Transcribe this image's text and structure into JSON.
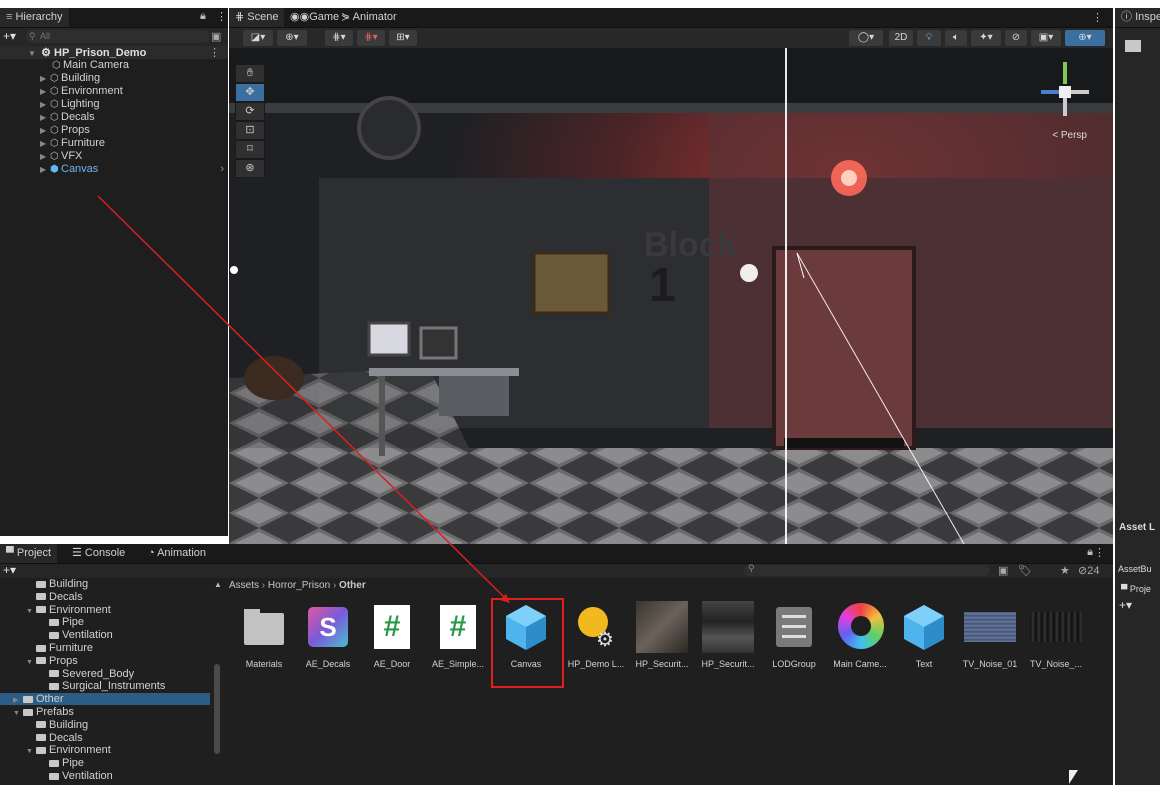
{
  "hierarchy": {
    "tab": "Hierarchy",
    "search_placeholder": "All",
    "root": "HP_Prison_Demo",
    "items": [
      "Main Camera",
      "Building",
      "Environment",
      "Lighting",
      "Decals",
      "Props",
      "Furniture",
      "VFX",
      "Canvas"
    ]
  },
  "scene": {
    "tabs": [
      "Scene",
      "Game",
      "Animator"
    ],
    "toolbar_2d": "2D",
    "persp_label": "< Persp",
    "wall_text": "Block",
    "wall_number": "1"
  },
  "inspector": {
    "tab": "Inspe",
    "asset_tab": "Asset L",
    "asset_bundle": "AssetBu",
    "proj": "Proje"
  },
  "project": {
    "tabs": [
      "Project",
      "Console",
      "Animation"
    ],
    "breadcrumb": [
      "Assets",
      "Horror_Prison",
      "Other"
    ],
    "hidden_count": "24",
    "tree": [
      {
        "label": "Building",
        "indent": 2,
        "open": false
      },
      {
        "label": "Decals",
        "indent": 2,
        "open": false
      },
      {
        "label": "Environment",
        "indent": 2,
        "open": true
      },
      {
        "label": "Pipe",
        "indent": 3,
        "open": false
      },
      {
        "label": "Ventilation",
        "indent": 3,
        "open": false
      },
      {
        "label": "Furniture",
        "indent": 2,
        "open": false
      },
      {
        "label": "Props",
        "indent": 2,
        "open": true
      },
      {
        "label": "Severed_Body",
        "indent": 3,
        "open": false
      },
      {
        "label": "Surgical_Instruments",
        "indent": 3,
        "open": false
      },
      {
        "label": "Other",
        "indent": 1,
        "open": false,
        "selected": true
      },
      {
        "label": "Prefabs",
        "indent": 1,
        "open": true
      },
      {
        "label": "Building",
        "indent": 2,
        "open": false
      },
      {
        "label": "Decals",
        "indent": 2,
        "open": false
      },
      {
        "label": "Environment",
        "indent": 2,
        "open": true
      },
      {
        "label": "Pipe",
        "indent": 3,
        "open": false
      },
      {
        "label": "Ventilation",
        "indent": 3,
        "open": false
      }
    ],
    "assets": [
      "Materials",
      "AE_Decals",
      "AE_Door",
      "AE_Simple...",
      "Canvas",
      "HP_Demo L...",
      "HP_Securit...",
      "HP_Securit...",
      "LODGroup",
      "Main Came...",
      "Text",
      "TV_Noise_01",
      "TV_Noise_..."
    ]
  },
  "colors": {
    "selection": "#2c5d87",
    "highlight": "#e02020",
    "accent": "#4ea3e6"
  }
}
